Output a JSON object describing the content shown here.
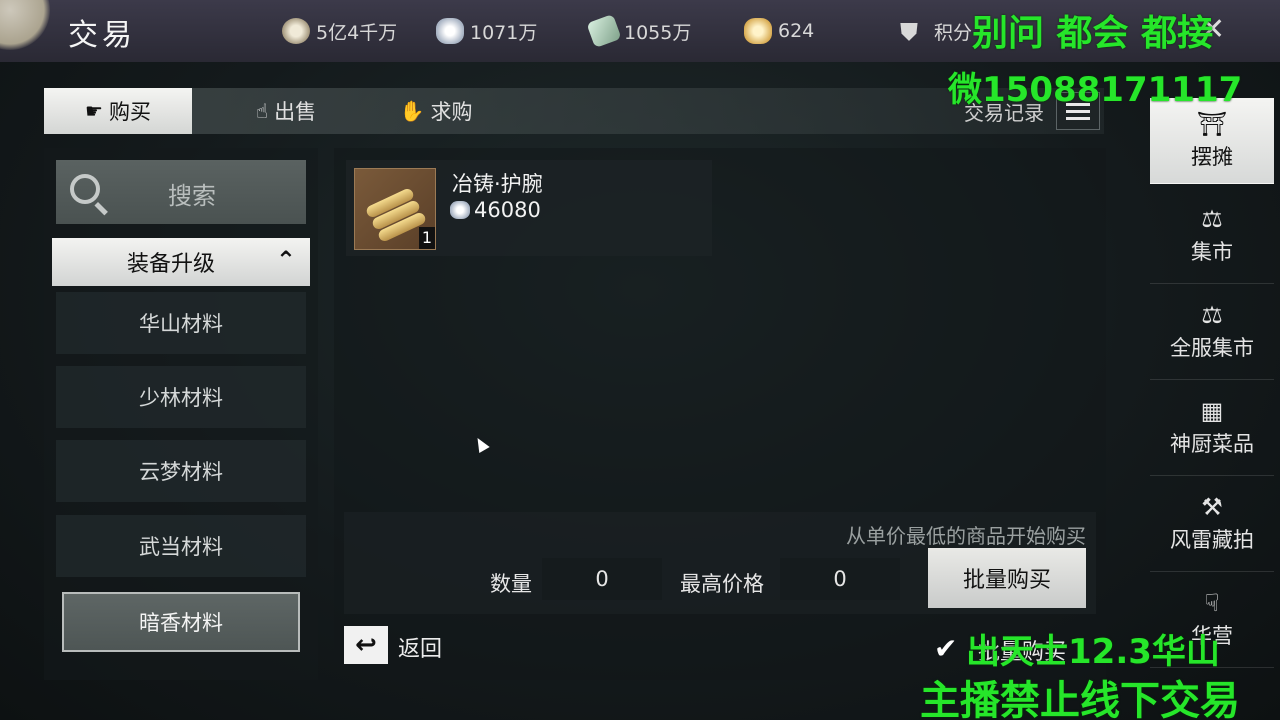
{
  "header": {
    "title": "交易",
    "currencies": [
      {
        "icon": "coin-icon",
        "value": "5亿4千万"
      },
      {
        "icon": "silver-icon",
        "value": "1071万"
      },
      {
        "icon": "ticket-icon",
        "value": "1055万"
      },
      {
        "icon": "gold-icon",
        "value": "624"
      },
      {
        "icon": "shield-icon",
        "value": "积分"
      }
    ]
  },
  "watermarks": {
    "top_line1": "别问 都会 都接",
    "top_line2": "微15088171117",
    "bottom_line1": "出天士12.3华山",
    "bottom_line2": "主播禁止线下交易"
  },
  "tabs": [
    {
      "label": "购买",
      "icon": "buy-icon",
      "active": true
    },
    {
      "label": "出售",
      "icon": "sell-icon",
      "active": false
    },
    {
      "label": "求购",
      "icon": "request-icon",
      "active": false
    }
  ],
  "trade_record_label": "交易记录",
  "left": {
    "search_label": "搜索",
    "category": "装备升级",
    "subcategories": [
      "华山材料",
      "少林材料",
      "云梦材料",
      "武当材料",
      "暗香材料"
    ],
    "selected": "暗香材料"
  },
  "item": {
    "name": "冶铸·护腕",
    "price": "46080",
    "quantity": "1"
  },
  "batch": {
    "hint": "从单价最低的商品开始购买",
    "qty_label": "数量",
    "qty_value": "0",
    "max_price_label": "最高价格",
    "max_price_value": "0",
    "button": "批量购买"
  },
  "footer": {
    "back_label": "返回",
    "batch_checkbox_label": "批量购买"
  },
  "sidebar": [
    {
      "label": "摆摊",
      "icon": "stall-icon",
      "active": true
    },
    {
      "label": "集市",
      "icon": "scale-icon",
      "active": false
    },
    {
      "label": "全服集市",
      "icon": "global-scale-icon",
      "active": false
    },
    {
      "label": "神厨菜品",
      "icon": "kitchen-icon",
      "active": false
    },
    {
      "label": "风雷藏拍",
      "icon": "auction-gavel-icon",
      "active": false
    },
    {
      "label": "华营",
      "icon": "hand-icon",
      "active": false
    }
  ]
}
